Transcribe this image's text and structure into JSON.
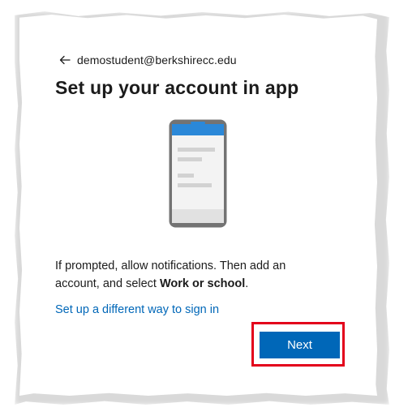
{
  "account": {
    "email": "demostudent@berkshirecc.edu"
  },
  "page": {
    "title": "Set up your account in app",
    "instruction_prefix": "If prompted, allow notifications. Then add an account, and select ",
    "instruction_bold": "Work or school",
    "instruction_suffix": ".",
    "alt_link_label": "Set up a different way to sign in",
    "next_label": "Next"
  },
  "icons": {
    "back": "back-arrow-icon",
    "illustration": "phone-illustration"
  },
  "colors": {
    "accent": "#0067b8",
    "phone_screen_header": "#2b88d8",
    "phone_frame": "#737373",
    "highlight": "#e3001b"
  }
}
